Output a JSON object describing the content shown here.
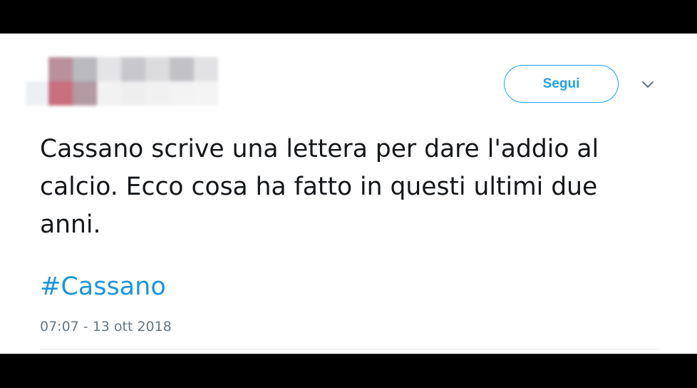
{
  "tweet": {
    "follow_label": "Segui",
    "text": "Cassano scrive una lettera per dare l'addio al calcio. Ecco cosa ha fatto in questi ultimi due anni.",
    "hashtag": "#Cassano",
    "timestamp": "07:07 - 13 ott 2018"
  },
  "colors": {
    "accent": "#1da1f2",
    "hashtag": "#1b95e0",
    "text": "#14171a",
    "muted": "#657786"
  },
  "icons": {
    "menu": "chevron-down-icon",
    "avatar": "blurred-avatar"
  }
}
